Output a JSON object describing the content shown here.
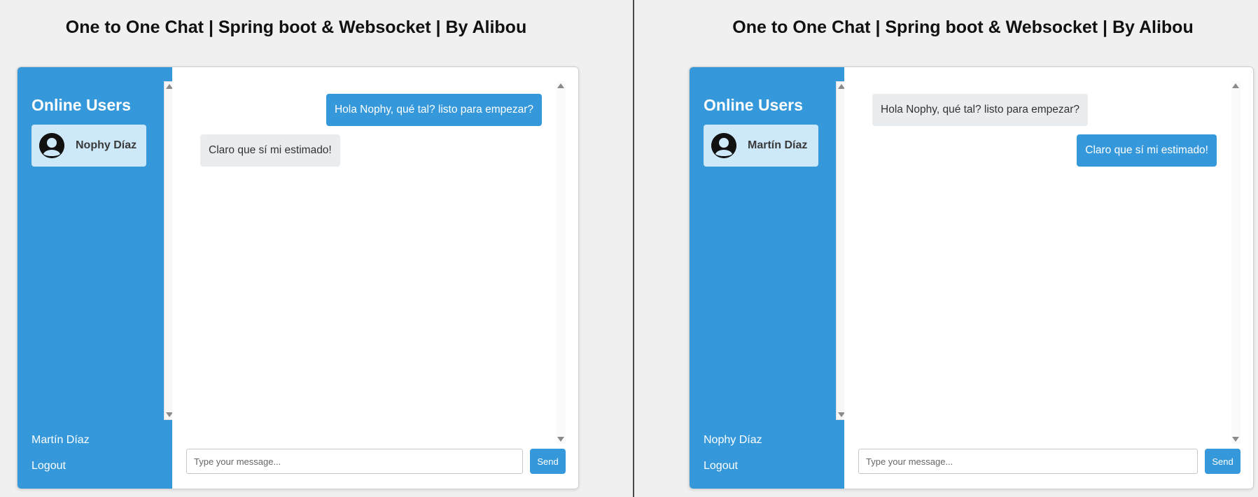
{
  "left_window": {
    "page_title": "One to One Chat | Spring boot & Websocket | By Alibou",
    "sidebar": {
      "title": "Online Users",
      "users": [
        {
          "name": "Nophy Díaz",
          "avatar_icon": "user-avatar-icon"
        }
      ],
      "connected_user": "Martín Díaz",
      "logout_label": "Logout"
    },
    "messages": [
      {
        "text": "Hola Nophy, qué tal? listo para empezar?",
        "type": "sender"
      },
      {
        "text": "Claro que sí mi estimado!",
        "type": "receiver"
      }
    ],
    "input_placeholder": "Type your message...",
    "send_label": "Send"
  },
  "right_window": {
    "page_title": "One to One Chat | Spring boot & Websocket | By Alibou",
    "sidebar": {
      "title": "Online Users",
      "users": [
        {
          "name": "Martín Díaz",
          "avatar_icon": "user-avatar-icon"
        }
      ],
      "connected_user": "Nophy Díaz",
      "logout_label": "Logout"
    },
    "messages": [
      {
        "text": "Hola Nophy, qué tal? listo para empezar?",
        "type": "receiver"
      },
      {
        "text": "Claro que sí mi estimado!",
        "type": "sender"
      }
    ],
    "input_placeholder": "Type your message...",
    "send_label": "Send"
  },
  "colors": {
    "accent": "#3598db",
    "selected_user_bg": "#cde8f8",
    "receiver_bubble": "#e9edef",
    "page_bg": "#f0f0f0"
  }
}
